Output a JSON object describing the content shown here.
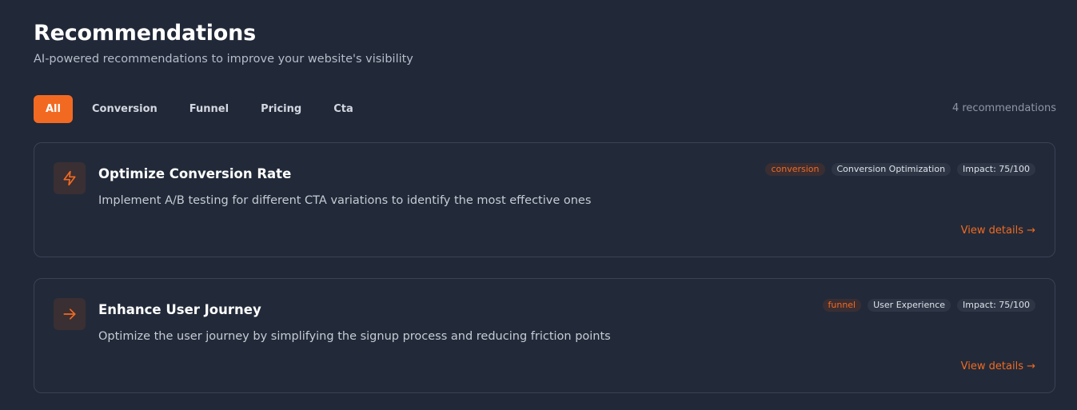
{
  "header": {
    "title": "Recommendations",
    "subtitle": "AI-powered recommendations to improve your website's visibility"
  },
  "filters": [
    {
      "label": "All",
      "active": true
    },
    {
      "label": "Conversion",
      "active": false
    },
    {
      "label": "Funnel",
      "active": false
    },
    {
      "label": "Pricing",
      "active": false
    },
    {
      "label": "Cta",
      "active": false
    }
  ],
  "count_label": "4 recommendations",
  "accent_color": "#f26a21",
  "recommendations": [
    {
      "icon": "lightning-icon",
      "title": "Optimize Conversion Rate",
      "description": "Implement A/B testing for different CTA variations to identify the most effective ones",
      "category_tag": "conversion",
      "type_tag": "Conversion Optimization",
      "impact_tag": "Impact: 75/100",
      "link_label": "View details →"
    },
    {
      "icon": "arrow-right-icon",
      "title": "Enhance User Journey",
      "description": "Optimize the user journey by simplifying the signup process and reducing friction points",
      "category_tag": "funnel",
      "type_tag": "User Experience",
      "impact_tag": "Impact: 75/100",
      "link_label": "View details →"
    }
  ]
}
